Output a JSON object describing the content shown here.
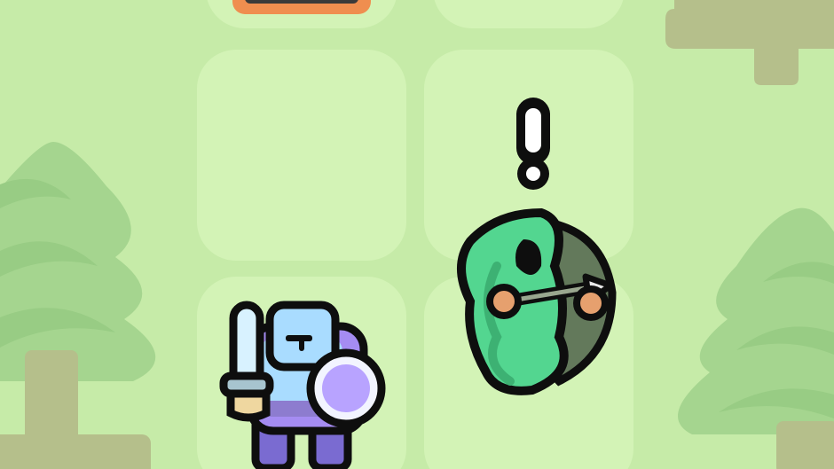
{
  "scene": {
    "background_color": "#c6eba8",
    "tile_color": "#d3f3b6",
    "tree_color": "#a5d58f",
    "tree_trunk_color": "#b5bf8b",
    "outline_color": "#0e0e0e"
  },
  "board": {
    "tiles": [
      {
        "name": "board-tile-top-left",
        "interactive": true
      },
      {
        "name": "board-tile-top-right",
        "interactive": true
      },
      {
        "name": "board-tile-middle-left",
        "interactive": true
      },
      {
        "name": "board-tile-middle-right",
        "interactive": true
      },
      {
        "name": "board-tile-bottom-left",
        "interactive": true
      },
      {
        "name": "board-tile-bottom-right",
        "interactive": true
      }
    ]
  },
  "units": {
    "knight": {
      "icon": "knight-with-sword-and-shield",
      "body_color": "#a9dcff",
      "armor_color": "#a58cf2",
      "shield_color": "#b8a3ff"
    },
    "archer": {
      "icon": "hooded-archer-with-bow",
      "cloak_color": "#53d690",
      "bow_color": "#63795b",
      "alert_icon": "exclamation-mark-icon"
    },
    "offscreen_unit": {
      "icon": "partial-unit-card",
      "border_color": "#ef8e4f"
    }
  }
}
